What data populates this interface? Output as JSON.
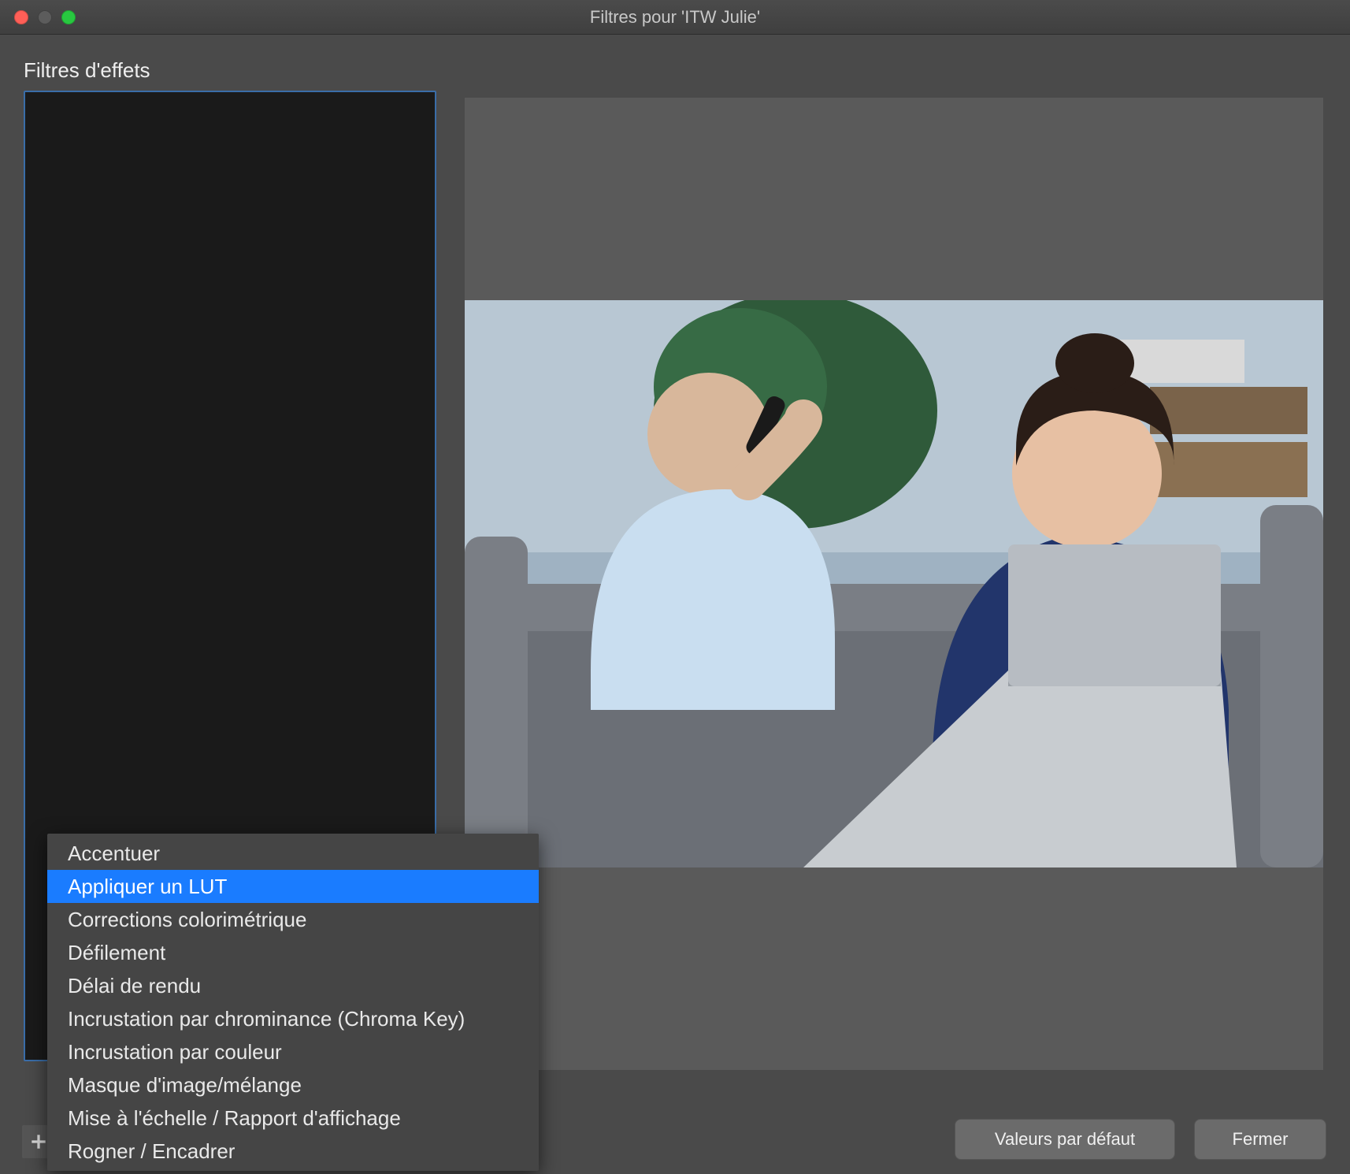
{
  "window": {
    "title": "Filtres pour 'ITW Julie'"
  },
  "sidebar": {
    "title": "Filtres d'effets"
  },
  "footer": {
    "defaults_label": "Valeurs par défaut",
    "close_label": "Fermer"
  },
  "menu": {
    "items": [
      {
        "label": "Accentuer",
        "selected": false
      },
      {
        "label": "Appliquer un LUT",
        "selected": true
      },
      {
        "label": "Corrections colorimétrique",
        "selected": false
      },
      {
        "label": "Défilement",
        "selected": false
      },
      {
        "label": "Délai de rendu",
        "selected": false
      },
      {
        "label": "Incrustation par chrominance (Chroma Key)",
        "selected": false
      },
      {
        "label": "Incrustation par couleur",
        "selected": false
      },
      {
        "label": "Masque d'image/mélange",
        "selected": false
      },
      {
        "label": "Mise à l'échelle / Rapport d'affichage",
        "selected": false
      },
      {
        "label": "Rogner / Encadrer",
        "selected": false
      }
    ]
  },
  "icons": {
    "close_window": "close-icon",
    "minimize_window": "minimize-icon",
    "zoom_window": "zoom-icon",
    "add": "plus-icon",
    "remove": "minus-icon",
    "move_up": "chevron-up-icon",
    "move_down": "chevron-down-icon"
  },
  "colors": {
    "accent": "#1a7cff",
    "list_border": "#3a6da8",
    "window_bg": "#4a4a4a",
    "panel_bg": "#5a5a5a"
  }
}
